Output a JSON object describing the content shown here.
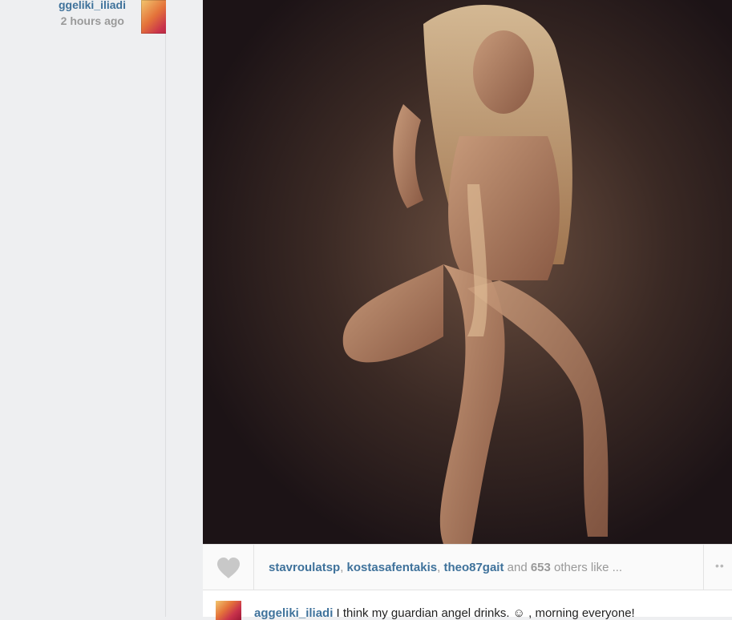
{
  "author": {
    "username": "ggeliki_iliadi",
    "time": "2 hours ago"
  },
  "likes": {
    "users": [
      "stavroulatsp",
      "kostasafentakis",
      "theo87gait"
    ],
    "separator": ", ",
    "and_text": " and ",
    "count": "653",
    "suffix": " others like ...",
    "more_label": "••"
  },
  "caption": {
    "username": "aggeliki_iliadi",
    "text": " I think my guardian angel drinks. ☺ , morning everyone!"
  },
  "icons": {
    "like": "heart-icon",
    "more": "more-dots-icon"
  },
  "colors": {
    "link": "#3f729b",
    "muted": "#999999",
    "background": "#eeeff1"
  }
}
